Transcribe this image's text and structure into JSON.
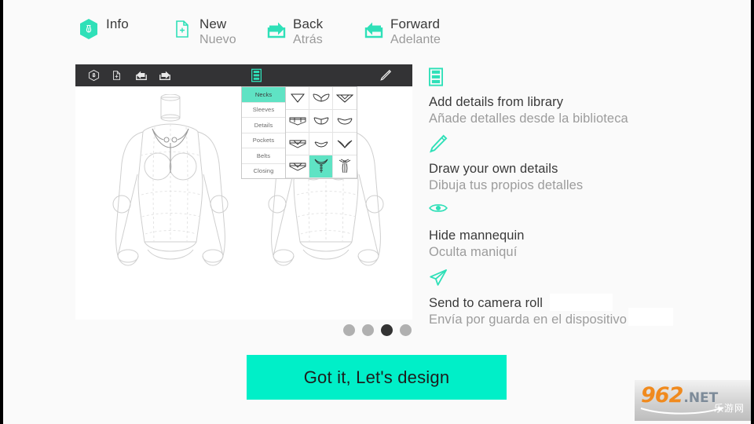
{
  "help_row": {
    "items": [
      {
        "icon": "info-hexagon-icon",
        "en": "Info",
        "es": ""
      },
      {
        "icon": "new-document-icon",
        "en": "New",
        "es": "Nuevo"
      },
      {
        "icon": "back-arrow-icon",
        "en": "Back",
        "es": "Atrás"
      },
      {
        "icon": "forward-arrow-icon",
        "en": "Forward",
        "es": "Adelante"
      }
    ]
  },
  "app": {
    "toolbar": {
      "icons": [
        "mannequin-badge-icon",
        "new-file-icon",
        "undo-icon",
        "redo-icon",
        "library-icon",
        "pencil-icon",
        "eye-icon",
        "send-icon"
      ]
    },
    "library": {
      "categories": [
        "Necks",
        "Sleeves",
        "Details",
        "Pockets",
        "Belts",
        "Closing"
      ],
      "active_category": "Necks",
      "selected_cell_index": 10,
      "cell_count": 12
    }
  },
  "pager": {
    "count": 4,
    "active_index": 2
  },
  "hints": [
    {
      "icon": "library-icon",
      "en": "Add details from library",
      "es": "Añade detalles desde la biblioteca"
    },
    {
      "icon": "pencil-icon",
      "en": "Draw your own details",
      "es": "Dibuja tus propios detalles"
    },
    {
      "icon": "eye-icon",
      "en": "Hide mannequin",
      "es": "Oculta maniquí"
    },
    {
      "icon": "send-icon",
      "en": "Send to camera roll",
      "es": "Envía por guarda en el dispositivo"
    }
  ],
  "cta": {
    "label": "Got it, Let's design"
  },
  "watermark": {
    "brand": "962",
    "tld": ".NET",
    "cn": "乐游网"
  },
  "colors": {
    "accent": "#00efc8",
    "accent_soft": "#5fe3c4",
    "toolbar_bg": "#333335",
    "page_bg": "#fafafa",
    "text_primary": "#3a3a3a",
    "text_secondary": "#9c9c9c",
    "dot_inactive": "#b0b0b0",
    "dot_active": "#333333"
  }
}
